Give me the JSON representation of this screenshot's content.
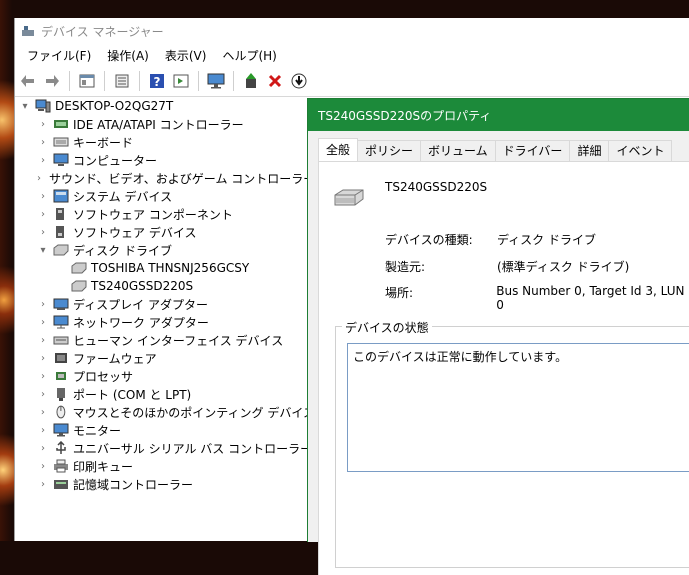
{
  "window": {
    "title": "デバイス マネージャー"
  },
  "menu": [
    "ファイル(F)",
    "操作(A)",
    "表示(V)",
    "ヘルプ(H)"
  ],
  "toolbar_icons": [
    "back-icon",
    "forward-icon",
    "properties-grid-icon",
    "list-icon",
    "help-icon",
    "view-icon",
    "monitor-icon",
    "update-driver-icon",
    "uninstall-icon",
    "scan-hardware-icon"
  ],
  "tree": {
    "root": "DESKTOP-O2QG27T",
    "items": [
      {
        "label": "IDE ATA/ATAPI コントローラー",
        "icon": "ide-icon",
        "expanded": false
      },
      {
        "label": "キーボード",
        "icon": "keyboard-icon",
        "expanded": false
      },
      {
        "label": "コンピューター",
        "icon": "computer-icon",
        "expanded": false
      },
      {
        "label": "サウンド、ビデオ、およびゲーム コントローラー",
        "icon": "sound-icon",
        "expanded": false
      },
      {
        "label": "システム デバイス",
        "icon": "system-icon",
        "expanded": false
      },
      {
        "label": "ソフトウェア コンポーネント",
        "icon": "software-component-icon",
        "expanded": false
      },
      {
        "label": "ソフトウェア デバイス",
        "icon": "software-device-icon",
        "expanded": false
      },
      {
        "label": "ディスク ドライブ",
        "icon": "disk-icon",
        "expanded": true,
        "children": [
          "TOSHIBA THNSNJ256GCSY",
          "TS240GSSD220S"
        ]
      },
      {
        "label": "ディスプレイ アダプター",
        "icon": "display-icon",
        "expanded": false
      },
      {
        "label": "ネットワーク アダプター",
        "icon": "network-icon",
        "expanded": false
      },
      {
        "label": "ヒューマン インターフェイス デバイス",
        "icon": "hid-icon",
        "expanded": false
      },
      {
        "label": "ファームウェア",
        "icon": "firmware-icon",
        "expanded": false
      },
      {
        "label": "プロセッサ",
        "icon": "processor-icon",
        "expanded": false
      },
      {
        "label": "ポート (COM と LPT)",
        "icon": "port-icon",
        "expanded": false
      },
      {
        "label": "マウスとそのほかのポインティング デバイス",
        "icon": "mouse-icon",
        "expanded": false
      },
      {
        "label": "モニター",
        "icon": "monitor-icon",
        "expanded": false
      },
      {
        "label": "ユニバーサル シリアル バス コントローラー",
        "icon": "usb-icon",
        "expanded": false
      },
      {
        "label": "印刷キュー",
        "icon": "printer-icon",
        "expanded": false
      },
      {
        "label": "記憶域コントローラー",
        "icon": "storage-icon",
        "expanded": false
      }
    ]
  },
  "dialog": {
    "title": "TS240GSSD220Sのプロパティ",
    "tabs": [
      "全般",
      "ポリシー",
      "ボリューム",
      "ドライバー",
      "詳細",
      "イベント"
    ],
    "active_tab": "全般",
    "device_name": "TS240GSSD220S",
    "props": [
      {
        "label": "デバイスの種類:",
        "value": "ディスク ドライブ"
      },
      {
        "label": "製造元:",
        "value": "(標準ディスク ドライブ)"
      },
      {
        "label": "場所:",
        "value": "Bus Number 0, Target Id 3, LUN 0"
      }
    ],
    "status_group_label": "デバイスの状態",
    "status_text": "このデバイスは正常に動作しています。"
  },
  "colors": {
    "dialog_title_bg": "#1c8a3a",
    "status_border": "#7a9cc5"
  }
}
